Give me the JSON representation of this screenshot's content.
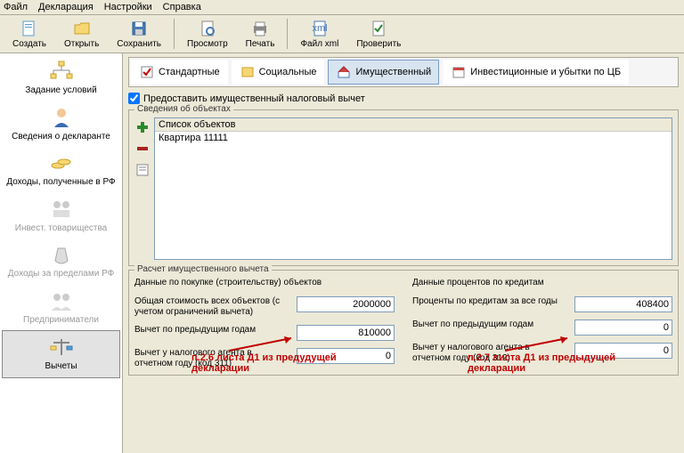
{
  "menu": {
    "file": "Файл",
    "decl": "Декларация",
    "settings": "Настройки",
    "help": "Справка"
  },
  "toolbar": {
    "create": "Создать",
    "open": "Открыть",
    "save": "Сохранить",
    "preview": "Просмотр",
    "print": "Печать",
    "filexml": "Файл xml",
    "check": "Проверить"
  },
  "sidebar": {
    "conditions": "Задание условий",
    "declarant": "Сведения о декларанте",
    "income_rf": "Доходы, полученные в РФ",
    "invest": "Инвест. товарищества",
    "income_abroad": "Доходы за пределами РФ",
    "entrepreneurs": "Предприниматели",
    "deductions": "Вычеты"
  },
  "tabs": {
    "standard": "Стандартные",
    "social": "Социальные",
    "property": "Имущественный",
    "invest_loss": "Инвестиционные и убытки по ЦБ"
  },
  "grant_checkbox": "Предоставить имущественный налоговый вычет",
  "objects": {
    "group_title": "Сведения об объектах",
    "header": "Список объектов",
    "items": [
      "Квартира 11111"
    ]
  },
  "calc": {
    "group_title": "Расчет имущественного вычета",
    "left": {
      "heading": "Данные по покупке (строительству) объектов",
      "total_cost_lbl": "Общая стоимость всех объектов (с учетом ограничений вычета)",
      "total_cost_val": "2000000",
      "prev_years_lbl": "Вычет по предыдущим годам",
      "prev_years_val": "810000",
      "agent_lbl": "Вычет у налогового агента в отчетном году (код 311)",
      "agent_val": "0"
    },
    "right": {
      "heading": "Данные процентов по кредитам",
      "interest_lbl": "Проценты по кредитам за все годы",
      "interest_val": "408400",
      "prev_years_lbl": "Вычет по предыдущим годам",
      "prev_years_val": "0",
      "agent_lbl": "Вычет у налогового агента в отчетном году (код 312)",
      "agent_val": "0"
    }
  },
  "annotations": {
    "left": "п.2.6 листа Д1 из предудущей декларации",
    "right": "п.2.7 листа Д1 из предыдущей декларации"
  }
}
